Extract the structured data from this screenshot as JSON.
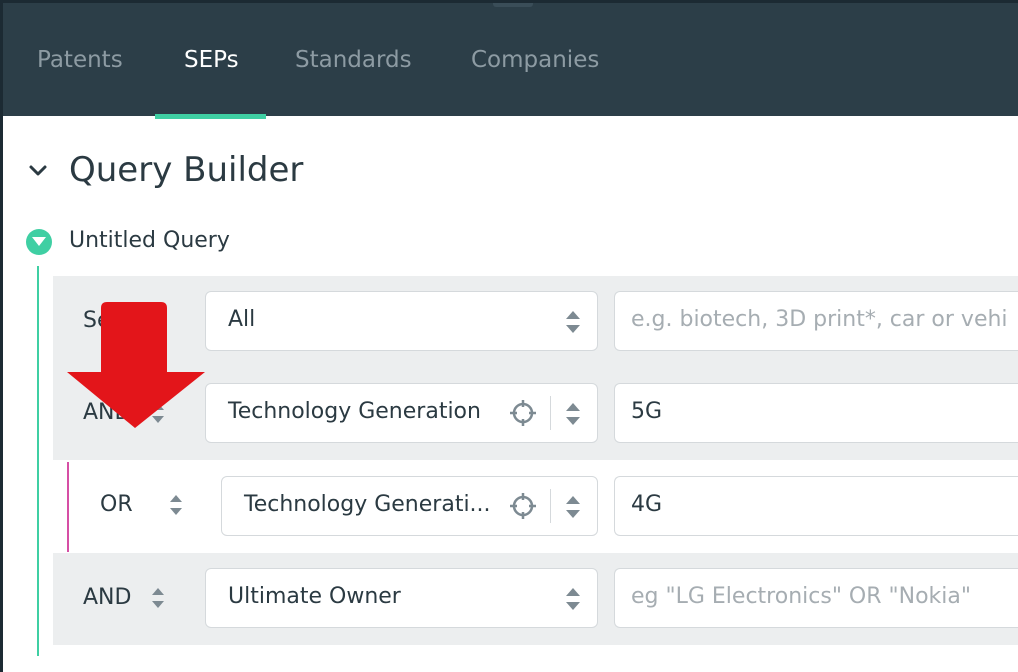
{
  "nav": {
    "tabs": [
      {
        "label": "Patents",
        "active": false
      },
      {
        "label": "SEPs",
        "active": true
      },
      {
        "label": "Standards",
        "active": false
      },
      {
        "label": "Companies",
        "active": false
      }
    ]
  },
  "query_builder": {
    "title": "Query Builder",
    "query_name": "Untitled Query",
    "rows": [
      {
        "operator": "Se",
        "field": "All",
        "value": "",
        "placeholder": "e.g. biotech, 3D print*, car or vehi"
      },
      {
        "operator": "AND",
        "field": "Technology Generation",
        "value": "5G",
        "placeholder": ""
      },
      {
        "operator": "OR",
        "field": "Technology Generati...",
        "value": "4G",
        "placeholder": ""
      },
      {
        "operator": "AND",
        "field": "Ultimate Owner",
        "value": "",
        "placeholder": "eg \"LG Electronics\" OR \"Nokia\""
      }
    ]
  },
  "colors": {
    "nav_bg": "#2c3e48",
    "accent": "#3fcfa3",
    "nested_line": "#d64fa5",
    "annotation": "#e3151a"
  },
  "icons": {
    "collapse": "chevron-down-icon",
    "query_toggle": "caret-down-circle-icon",
    "sort": "up-down-arrows-icon",
    "locate": "crosshair-icon",
    "annotation": "red-down-arrow-icon"
  }
}
